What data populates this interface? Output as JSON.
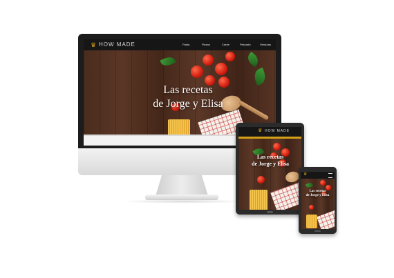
{
  "brand": {
    "name": "HOW MADE"
  },
  "nav": {
    "items": [
      "Pasta",
      "Pizzas",
      "Carne",
      "Pescado",
      "Verduras"
    ]
  },
  "hero": {
    "line1": "Las recetas",
    "line2": "de Jorge y Elisa"
  },
  "colors": {
    "accent": "#d4a017",
    "nav_bg": "#161616",
    "device_frame": "#2b2b2b",
    "monitor_silver": "#e6e6e6"
  }
}
